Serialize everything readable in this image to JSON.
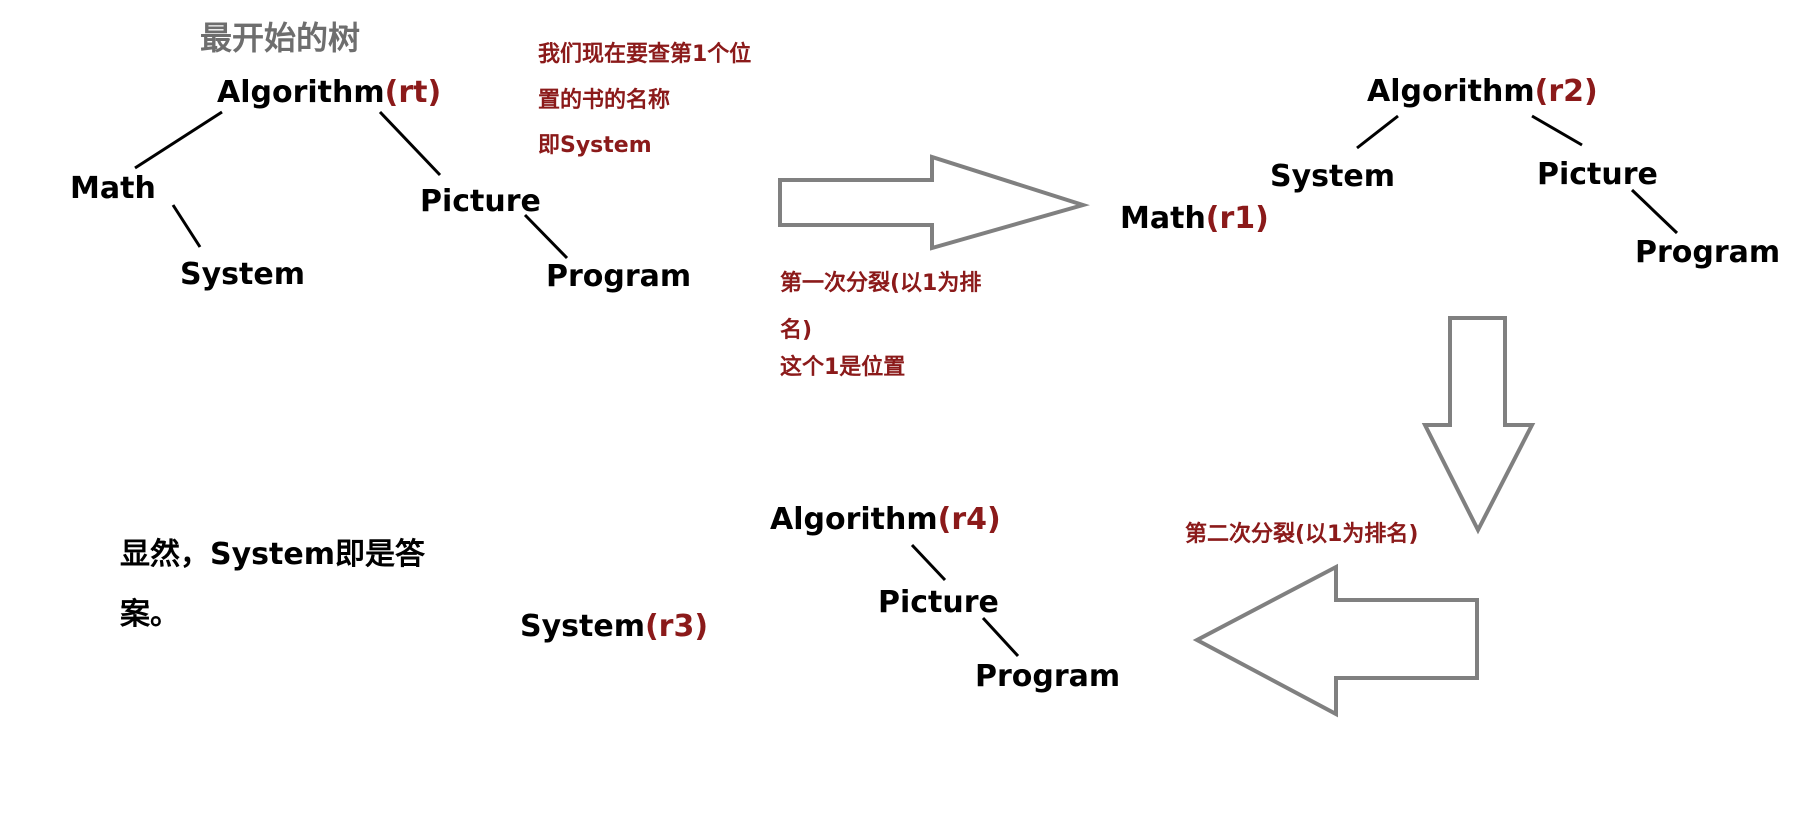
{
  "title": "最开始的树",
  "note_query": [
    "我们现在要查第1个位",
    "置的书的名称",
    "即System"
  ],
  "tree_initial": {
    "root": "Algorithm",
    "root_tag": "(rt)",
    "math": "Math",
    "system": "System",
    "picture": "Picture",
    "program": "Program"
  },
  "split1_label": [
    "第一次分裂(以1为排",
    "名)",
    "这个1是位置"
  ],
  "tree_after_split1": {
    "math": "Math",
    "math_tag": "(r1)",
    "root": "Algorithm",
    "root_tag": "(r2)",
    "system": "System",
    "picture": "Picture",
    "program": "Program"
  },
  "split2_label": "第二次分裂(以1为排名)",
  "tree_after_split2": {
    "system": "System",
    "system_tag": "(r3)",
    "root": "Algorithm",
    "root_tag": "(r4)",
    "picture": "Picture",
    "program": "Program"
  },
  "conclusion": [
    "显然，System即是答",
    "案。"
  ],
  "colors": {
    "note": "#8b1a1a",
    "title": "#6e6e6e",
    "arrow": "#808080"
  }
}
